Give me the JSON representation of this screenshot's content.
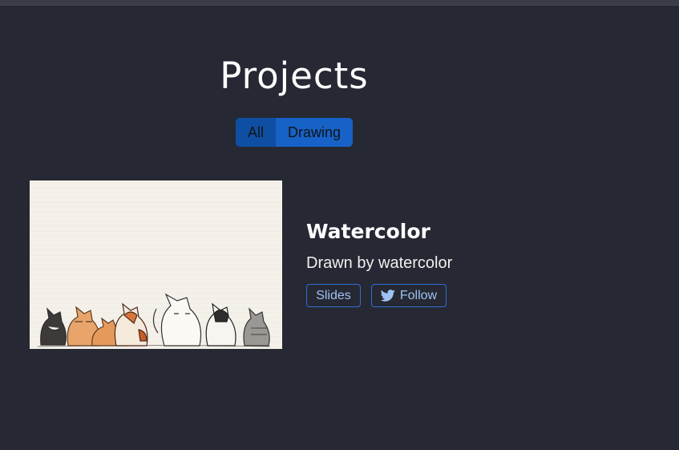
{
  "header": {
    "title": "Projects"
  },
  "filters": {
    "items": [
      {
        "label": "All",
        "active": true
      },
      {
        "label": "Drawing",
        "active": false
      }
    ]
  },
  "project": {
    "title": "Watercolor",
    "description": "Drawn by watercolor",
    "image_alt": "watercolor cats illustration",
    "buttons": {
      "slides_label": "Slides",
      "follow_label": "Follow",
      "follow_icon": "twitter-icon"
    }
  },
  "colors": {
    "background": "#262833",
    "accent": "#1762c6",
    "accent_dark": "#0f4fa3",
    "pill_text": "#9fc2f4"
  }
}
